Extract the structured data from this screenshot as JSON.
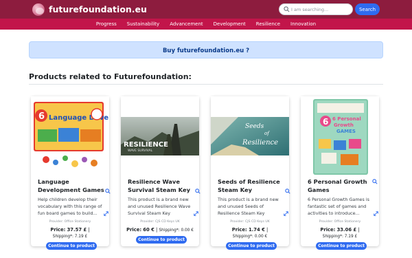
{
  "header": {
    "site_title": "futurefoundation.eu",
    "search_placeholder": "I am searching...",
    "search_button": "Search"
  },
  "nav": {
    "items": [
      "Progress",
      "Sustainability",
      "Advancement",
      "Development",
      "Resilience",
      "Innovation"
    ]
  },
  "banner": {
    "label": "Buy futurefoundation.eu ?"
  },
  "section": {
    "title": "Products related to Futurefoundation:"
  },
  "products": [
    {
      "title": "Language Development Games",
      "description": "Help children develop their vocabulary with this range of fun board games to build...",
      "provider": "Provider: Office Stationery",
      "price_label": "Price:",
      "price": "37.57 £",
      "shipping": "Shipping*: 7.19 £",
      "button": "Continue to product",
      "image_caption": "Language Development"
    },
    {
      "title": "Resilience Wave Survival Steam Key",
      "description": "This product is a brand new and unused Resilience Wave Survival Steam Key",
      "provider": "Provider: CJS CD Keys UK",
      "price_label": "Price:",
      "price": "60 €",
      "shipping": "Shipping*: 0.00 €",
      "button": "Continue to product",
      "image_caption": "RESILIENCE",
      "image_subcaption": "WAVE SURVIVAL"
    },
    {
      "title": "Seeds of Resilience Steam Key",
      "description": "This product is a brand new and unused Seeds of Resilience Steam Key",
      "provider": "Provider: CJS CD Keys UK",
      "price_label": "Price:",
      "price": "1.74 €",
      "shipping": "Shipping*: 0.00 €",
      "button": "Continue to product",
      "image_caption_line1": "Seeds",
      "image_caption_line2": "of",
      "image_caption_line3": "Resilience"
    },
    {
      "title": "6 Personal Growth Games",
      "description": "6 Personal Growth Games is fantastic set of games and activities to introduce...",
      "provider": "Provider: Office Stationery",
      "price_label": "Price:",
      "price": "33.06 £",
      "shipping": "Shipping*: 7.19 £",
      "button": "Continue to product",
      "image_caption_line1": "6 Personal",
      "image_caption_line2": "Growth",
      "image_caption_line3": "GAMES"
    }
  ],
  "colors": {
    "topbar": "#8d1c3e",
    "navbar": "#c2154a",
    "banner": "#cfe2ff",
    "accent": "#2f6bf0"
  }
}
